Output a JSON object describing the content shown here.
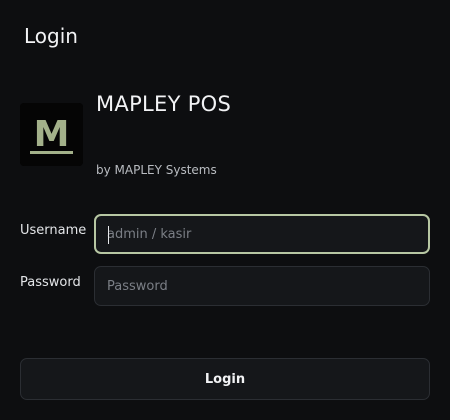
{
  "dialog": {
    "title": "Login"
  },
  "app": {
    "logo_letter": "M",
    "name": "MAPLEY POS",
    "vendor": "by MAPLEY Systems"
  },
  "form": {
    "username_label": "Username",
    "username_placeholder": "admin / kasir",
    "username_value": "",
    "password_label": "Password",
    "password_placeholder": "Password",
    "password_value": "",
    "submit_label": "Login"
  },
  "colors": {
    "background": "#0d0e10",
    "input_background": "#15171a",
    "focus_border": "#b7c7a3",
    "logo_accent": "#a3b18a"
  }
}
